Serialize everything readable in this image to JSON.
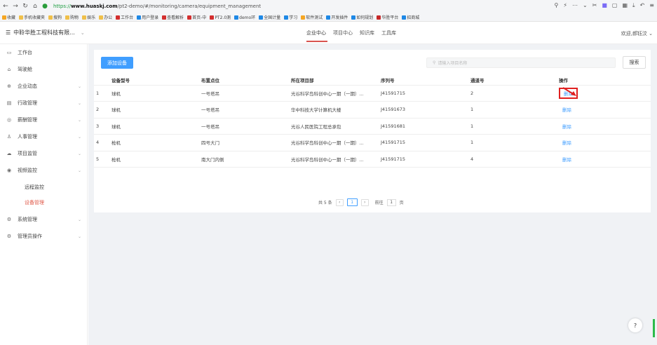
{
  "browser": {
    "url_scheme": "https://",
    "url_host": "www.huaskj.com",
    "url_path": "/pt2-demo/#/monitoring/camera/equipment_management",
    "bookmarks": [
      "收藏",
      "手机收藏夹",
      "搜狗",
      "购物",
      "娱乐",
      "办公",
      "工作台",
      "用户登录",
      "查看解析",
      "首页-中",
      "PT2.0测",
      "demo环",
      "全国计量",
      "学习",
      "软件测试",
      "开发插件",
      "如何规划",
      "华胜平台",
      "招商城"
    ]
  },
  "header": {
    "company": "中聆华胜工程科技有限...",
    "tabs": [
      "企业中心",
      "项目中心",
      "知识库",
      "工具库"
    ],
    "welcome": "欢迎,郝钰汶"
  },
  "sidebar": {
    "items": [
      {
        "label": "工作台",
        "icon": "monitor-icon",
        "has_arrow": false
      },
      {
        "label": "驾驶舱",
        "icon": "home-icon",
        "has_arrow": false
      },
      {
        "label": "企业动态",
        "icon": "globe-icon",
        "has_arrow": true
      },
      {
        "label": "行政管理",
        "icon": "list-icon",
        "has_arrow": true
      },
      {
        "label": "薪酬管理",
        "icon": "coin-icon",
        "has_arrow": true
      },
      {
        "label": "人事管理",
        "icon": "user-icon",
        "has_arrow": true
      },
      {
        "label": "项目监管",
        "icon": "cloud-icon",
        "has_arrow": true
      },
      {
        "label": "视频监控",
        "icon": "camera-icon",
        "has_arrow": true
      }
    ],
    "subitems": [
      {
        "label": "远程监控",
        "active": false
      },
      {
        "label": "设备管理",
        "active": true
      }
    ],
    "items_after": [
      {
        "label": "系统管理",
        "icon": "gear-icon",
        "has_arrow": true
      },
      {
        "label": "管理员操作",
        "icon": "gear-icon",
        "has_arrow": true
      }
    ]
  },
  "toolbar": {
    "add_label": "添加设备",
    "search_placeholder": "请输入项目名称",
    "search_label": "搜索"
  },
  "table": {
    "headers": [
      "",
      "设备型号",
      "布置点位",
      "所在项目部",
      "序列号",
      "通道号",
      "操作"
    ],
    "rows": [
      [
        "1",
        "球机",
        "一号塔吊",
        "光谷科学岛科创中心一期（一期）...",
        "J41591715",
        "2",
        "删除"
      ],
      [
        "2",
        "球机",
        "一号塔吊",
        "华中科技大学计算机大楼",
        "J41591673",
        "1",
        "删除"
      ],
      [
        "3",
        "球机",
        "一号塔吊",
        "光谷人民医院工程总承包",
        "J41591681",
        "1",
        "删除"
      ],
      [
        "4",
        "枪机",
        "四号大门",
        "光谷科学岛科创中心一期（一期）...",
        "J41591715",
        "1",
        "删除"
      ],
      [
        "5",
        "枪机",
        "南大门内侧",
        "光谷科学岛科创中心一期（一期）...",
        "J41591715",
        "4",
        "删除"
      ]
    ]
  },
  "pagination": {
    "total": "共 5 条",
    "current": "1",
    "goto_label": "前往",
    "goto_value": "1",
    "page_unit": "页"
  },
  "help_label": "?",
  "colors": {
    "accent": "#409eff",
    "active_red": "#e05a4a",
    "highlight": "#e02020"
  }
}
